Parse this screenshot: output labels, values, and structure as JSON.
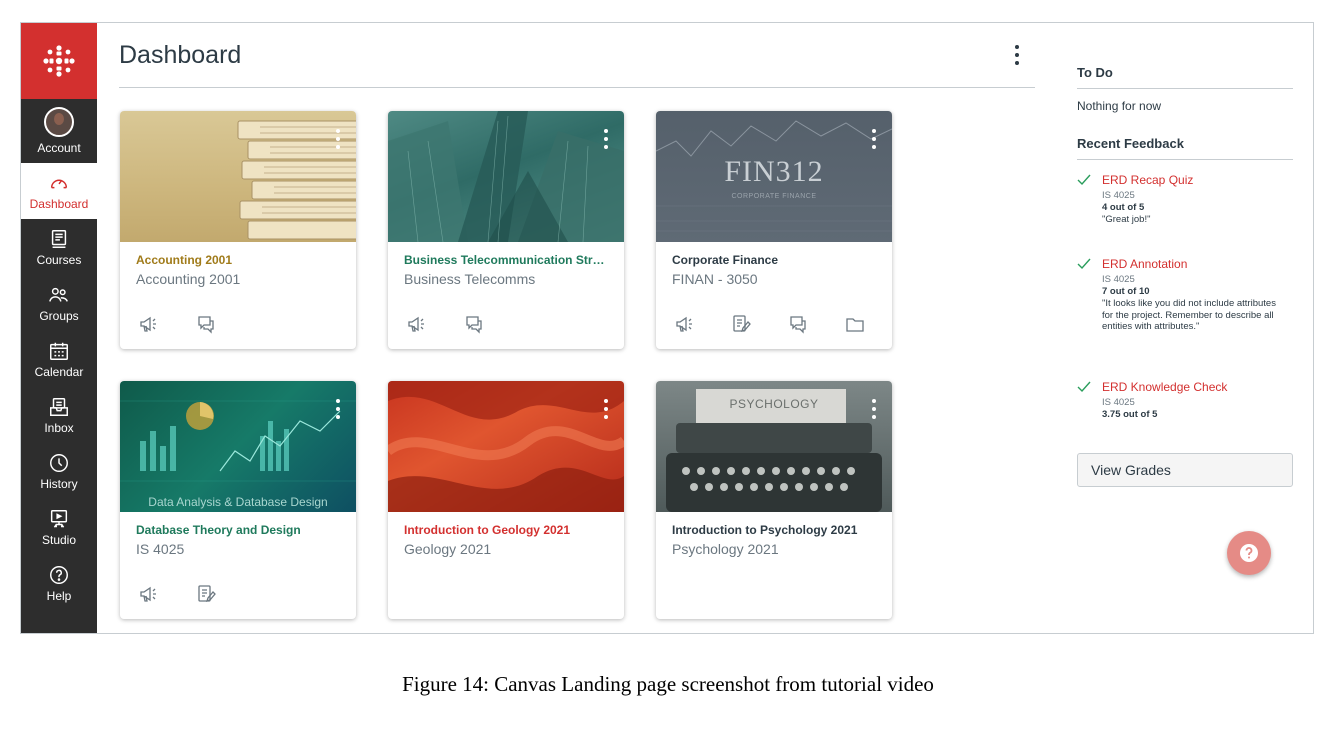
{
  "nav": {
    "items": [
      {
        "label": "Account"
      },
      {
        "label": "Dashboard"
      },
      {
        "label": "Courses"
      },
      {
        "label": "Groups"
      },
      {
        "label": "Calendar"
      },
      {
        "label": "Inbox"
      },
      {
        "label": "History"
      },
      {
        "label": "Studio"
      },
      {
        "label": "Help"
      }
    ]
  },
  "header": {
    "title": "Dashboard"
  },
  "cards": [
    {
      "title": "Accounting 2001",
      "subtitle": "Accounting 2001",
      "title_color": "#a07b1a"
    },
    {
      "title": "Business Telecommunication Strat...",
      "subtitle": "Business Telecomms",
      "title_color": "#1f7a5c"
    },
    {
      "title": "Corporate Finance",
      "subtitle": "FINAN - 3050",
      "title_color": "#2d3b45",
      "hero_text": "FIN312",
      "hero_subtext": "CORPORATE FINANCE"
    },
    {
      "title": "Database Theory and Design",
      "subtitle": "IS 4025",
      "title_color": "#1f7a5c",
      "hero_text": "Data Analysis & Database Design"
    },
    {
      "title": "Introduction to Geology 2021",
      "subtitle": "Geology 2021",
      "title_color": "#d3302f"
    },
    {
      "title": "Introduction to Psychology 2021",
      "subtitle": "Psychology 2021",
      "title_color": "#2d3b45",
      "hero_text": "PSYCHOLOGY"
    }
  ],
  "sidebar": {
    "todo_title": "To Do",
    "todo_empty": "Nothing for now",
    "feedback_title": "Recent Feedback",
    "feedback": [
      {
        "title": "ERD Recap Quiz",
        "course": "IS 4025",
        "score": "4 out of 5",
        "comment": "\"Great job!\""
      },
      {
        "title": "ERD Annotation",
        "course": "IS 4025",
        "score": "7 out of 10",
        "comment": "\"It looks like you did not include attributes for the project. Remember to describe all entities with attributes.\""
      },
      {
        "title": "ERD Knowledge Check",
        "course": "IS 4025",
        "score": "3.75 out of 5",
        "comment": ""
      }
    ],
    "view_grades": "View Grades"
  },
  "caption": "Figure 14: Canvas Landing page screenshot from tutorial video",
  "colors": {
    "brand": "#d3302f",
    "nav_bg": "#2d2d2d",
    "text": "#2d3b45"
  }
}
